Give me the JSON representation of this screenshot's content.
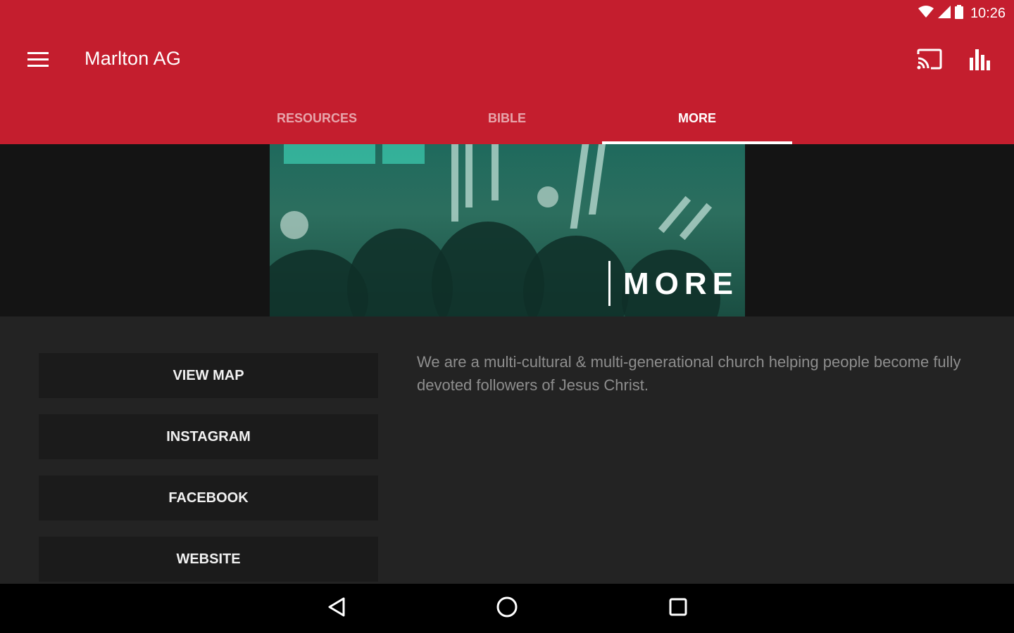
{
  "status_bar": {
    "time": "10:26"
  },
  "app_bar": {
    "title": "Marlton AG",
    "menu_icon": "menu-icon",
    "cast_icon": "cast-icon",
    "stats_icon": "bar-chart-icon",
    "color": "#c41e2e"
  },
  "tabs": [
    {
      "label": "RESOURCES",
      "active": false
    },
    {
      "label": "BIBLE",
      "active": false
    },
    {
      "label": "MORE",
      "active": true
    }
  ],
  "hero": {
    "word": "MORE"
  },
  "buttons": [
    {
      "label": "VIEW MAP"
    },
    {
      "label": "INSTAGRAM"
    },
    {
      "label": "FACEBOOK"
    },
    {
      "label": "WEBSITE"
    }
  ],
  "description": "We are a multi-cultural & multi-generational church helping people become fully devoted followers of Jesus Christ.",
  "nav_bar": {
    "back_icon": "back-icon",
    "home_icon": "home-icon",
    "recents_icon": "recents-icon"
  }
}
